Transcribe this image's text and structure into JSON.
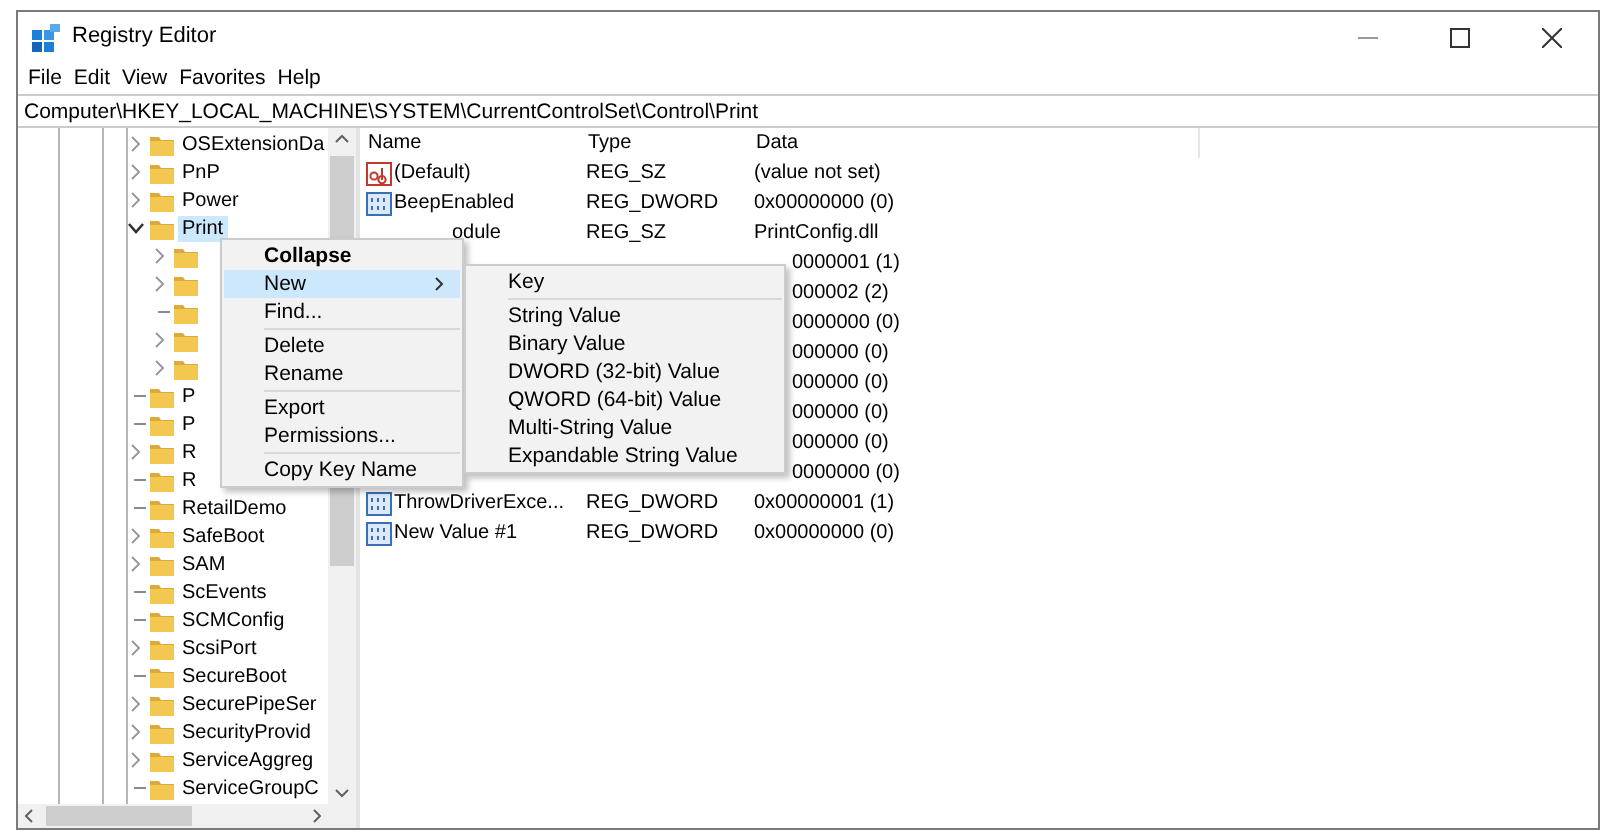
{
  "window": {
    "title": "Registry Editor"
  },
  "menu_bar": [
    "File",
    "Edit",
    "View",
    "Favorites",
    "Help"
  ],
  "address_bar": {
    "value": "Computer\\HKEY_LOCAL_MACHINE\\SYSTEM\\CurrentControlSet\\Control\\Print"
  },
  "tree": {
    "items": [
      {
        "label": "OSExtensionDa",
        "has_children": true,
        "expanded": false,
        "selected": false
      },
      {
        "label": "PnP",
        "has_children": true,
        "expanded": false,
        "selected": false
      },
      {
        "label": "Power",
        "has_children": true,
        "expanded": false,
        "selected": false
      },
      {
        "label": "Print",
        "has_children": true,
        "expanded": true,
        "selected": true,
        "children": [
          {
            "has_children": true,
            "expanded": false
          },
          {
            "has_children": true,
            "expanded": false
          },
          {
            "has_children": false
          },
          {
            "has_children": true,
            "expanded": false
          },
          {
            "has_children": true,
            "expanded": false
          }
        ]
      },
      {
        "label": "P",
        "has_children": false,
        "selected": false
      },
      {
        "label": "P",
        "has_children": false,
        "selected": false
      },
      {
        "label": "R",
        "has_children": true,
        "expanded": false,
        "selected": false
      },
      {
        "label": "R",
        "has_children": false,
        "selected": false
      },
      {
        "label": "RetailDemo",
        "has_children": false,
        "selected": false
      },
      {
        "label": "SafeBoot",
        "has_children": true,
        "expanded": false,
        "selected": false
      },
      {
        "label": "SAM",
        "has_children": true,
        "expanded": false,
        "selected": false
      },
      {
        "label": "ScEvents",
        "has_children": false,
        "selected": false
      },
      {
        "label": "SCMConfig",
        "has_children": false,
        "selected": false
      },
      {
        "label": "ScsiPort",
        "has_children": true,
        "expanded": false,
        "selected": false
      },
      {
        "label": "SecureBoot",
        "has_children": false,
        "selected": false
      },
      {
        "label": "SecurePipeSer",
        "has_children": true,
        "expanded": false,
        "selected": false
      },
      {
        "label": "SecurityProvid",
        "has_children": true,
        "expanded": false,
        "selected": false
      },
      {
        "label": "ServiceAggreg",
        "has_children": true,
        "expanded": false,
        "selected": false
      },
      {
        "label": "ServiceGroupC",
        "has_children": false,
        "selected": false
      }
    ]
  },
  "values": {
    "columns": [
      "Name",
      "Type",
      "Data"
    ],
    "rows": [
      {
        "kind": "string",
        "name": "(Default)",
        "type": "REG_SZ",
        "data": "(value not set)"
      },
      {
        "kind": "dword",
        "name": "BeepEnabled",
        "type": "REG_DWORD",
        "data": "0x00000000 (0)"
      },
      {
        "kind": "name_covered",
        "name": "odule",
        "type": "REG_SZ",
        "data": "PrintConfig.dll"
      },
      {
        "kind": "data_only",
        "data": "0000001 (1)"
      },
      {
        "kind": "data_only",
        "data": "000002 (2)"
      },
      {
        "kind": "data_only",
        "data": "0000000 (0)"
      },
      {
        "kind": "data_only",
        "data": "000000 (0)"
      },
      {
        "kind": "data_only",
        "data": "000000 (0)"
      },
      {
        "kind": "data_only",
        "data": "000000 (0)"
      },
      {
        "kind": "data_only",
        "data": "000000 (0)"
      },
      {
        "kind": "data_only",
        "data": "0000000 (0)"
      },
      {
        "kind": "dword",
        "name": "ThrowDriverExce...",
        "type": "REG_DWORD",
        "data": "0x00000001 (1)"
      },
      {
        "kind": "dword",
        "name": "New Value #1",
        "type": "REG_DWORD",
        "data": "0x00000000 (0)"
      }
    ]
  },
  "context_menu": {
    "items": [
      {
        "kind": "default",
        "label": "Collapse",
        "selected": false,
        "has_submenu": false
      },
      {
        "kind": "item",
        "label": "New",
        "selected": true,
        "has_submenu": true
      },
      {
        "kind": "item",
        "label": "Find...",
        "selected": false,
        "has_submenu": false
      },
      {
        "kind": "separator"
      },
      {
        "kind": "item",
        "label": "Delete",
        "selected": false,
        "has_submenu": false
      },
      {
        "kind": "item",
        "label": "Rename",
        "selected": false,
        "has_submenu": false
      },
      {
        "kind": "separator"
      },
      {
        "kind": "item",
        "label": "Export",
        "selected": false,
        "has_submenu": false
      },
      {
        "kind": "item",
        "label": "Permissions...",
        "selected": false,
        "has_submenu": false
      },
      {
        "kind": "separator"
      },
      {
        "kind": "item",
        "label": "Copy Key Name",
        "selected": false,
        "has_submenu": false
      }
    ]
  },
  "submenu": {
    "items": [
      {
        "kind": "item",
        "label": "Key",
        "selected": false
      },
      {
        "kind": "separator"
      },
      {
        "kind": "item",
        "label": "String Value",
        "selected": false
      },
      {
        "kind": "item",
        "label": "Binary Value",
        "selected": false
      },
      {
        "kind": "item",
        "label": "DWORD (32-bit) Value",
        "selected": false
      },
      {
        "kind": "item",
        "label": "QWORD (64-bit) Value",
        "selected": false
      },
      {
        "kind": "item",
        "label": "Multi-String Value",
        "selected": false
      },
      {
        "kind": "item",
        "label": "Expandable String Value",
        "selected": false
      }
    ]
  }
}
